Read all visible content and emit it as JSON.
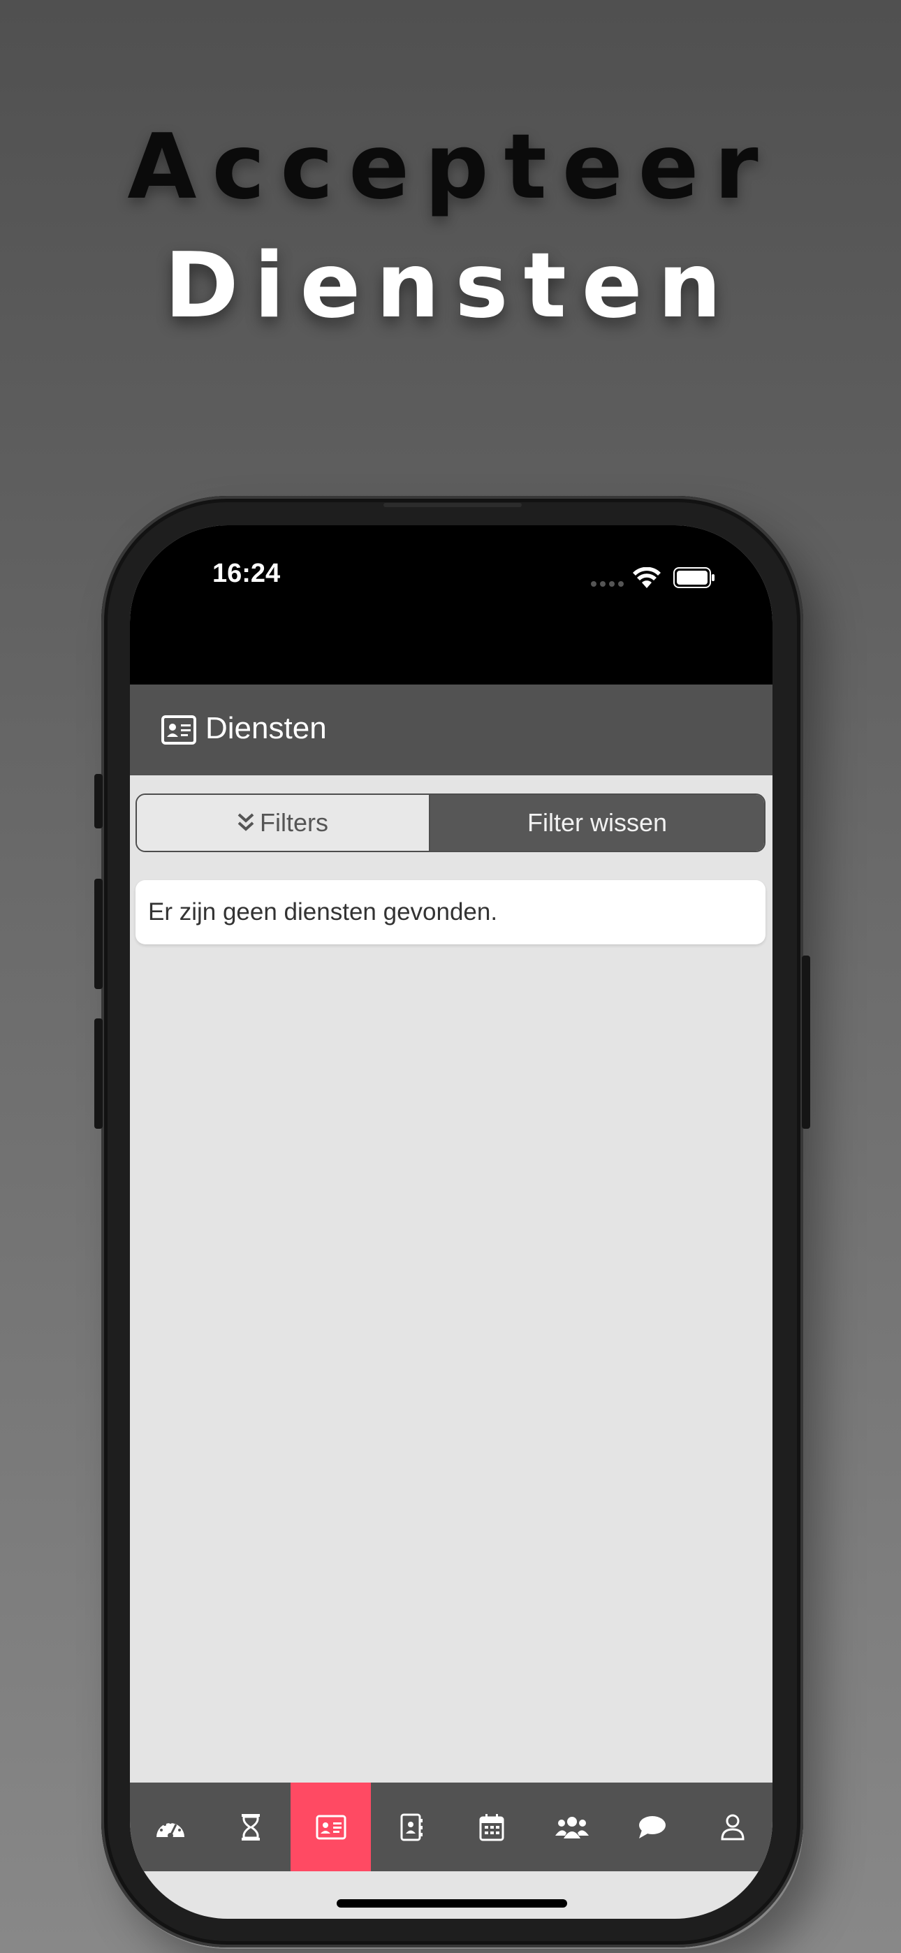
{
  "promo": {
    "line1": "Accepteer",
    "line2": "Diensten"
  },
  "status_bar": {
    "time": "16:24"
  },
  "header": {
    "title": "Diensten",
    "icon": "id-card-icon"
  },
  "filters": {
    "filters_label": "Filters",
    "clear_label": "Filter wissen"
  },
  "content": {
    "empty_message": "Er zijn geen diensten gevonden."
  },
  "tabbar": {
    "active_index": 2,
    "tabs": [
      {
        "icon": "dashboard-icon"
      },
      {
        "icon": "hourglass-icon"
      },
      {
        "icon": "id-card-icon"
      },
      {
        "icon": "address-book-icon"
      },
      {
        "icon": "calendar-icon"
      },
      {
        "icon": "users-icon"
      },
      {
        "icon": "chat-icon"
      },
      {
        "icon": "user-icon"
      }
    ]
  },
  "colors": {
    "accent": "#ff4a63",
    "header": "#525252",
    "background": "#e4e4e4"
  }
}
